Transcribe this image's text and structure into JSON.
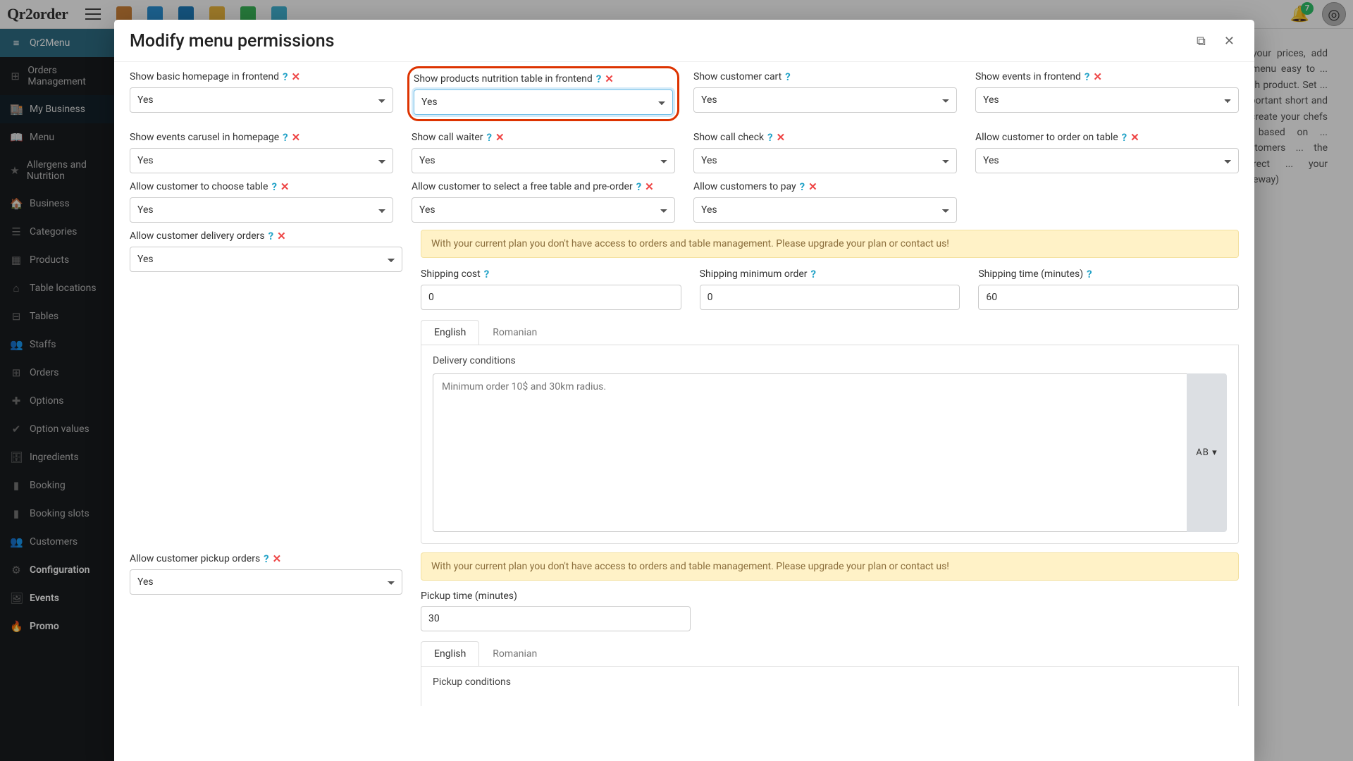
{
  "brand": "Qr2order",
  "notification_count": "7",
  "sidebar": {
    "items": [
      {
        "label": "Qr2Menu",
        "icon": "≡"
      },
      {
        "label": "Orders Management",
        "icon": "⊞"
      },
      {
        "label": "My Business",
        "icon": "🏬"
      },
      {
        "label": "Menu",
        "icon": "📖"
      },
      {
        "label": "Allergens and Nutrition",
        "icon": "★"
      },
      {
        "label": "Business",
        "icon": "🏠"
      },
      {
        "label": "Categories",
        "icon": "☰"
      },
      {
        "label": "Products",
        "icon": "▦"
      },
      {
        "label": "Table locations",
        "icon": "⌂"
      },
      {
        "label": "Tables",
        "icon": "⊟"
      },
      {
        "label": "Staffs",
        "icon": "👥"
      },
      {
        "label": "Orders",
        "icon": "⊞"
      },
      {
        "label": "Options",
        "icon": "✚"
      },
      {
        "label": "Option values",
        "icon": "✔"
      },
      {
        "label": "Ingredients",
        "icon": "🗄"
      },
      {
        "label": "Booking",
        "icon": "▮"
      },
      {
        "label": "Booking slots",
        "icon": "▮"
      },
      {
        "label": "Customers",
        "icon": "👥"
      },
      {
        "label": "Configuration",
        "icon": "⚙"
      },
      {
        "label": "Events",
        "icon": "🖼"
      },
      {
        "label": "Promo",
        "icon": "🔥"
      }
    ]
  },
  "bg_text": "... your prices, add ... menu easy to ... each product. Set ... important short and ... create your chefs ... based on ... customers ... the correct ... your gateway)",
  "modal": {
    "title": "Modify menu permissions",
    "rows": [
      [
        {
          "label": "Show basic homepage in frontend",
          "value": "Yes",
          "help": true,
          "remove": true,
          "highlight": false
        },
        {
          "label": "Show products nutrition table in frontend",
          "value": "Yes",
          "help": true,
          "remove": true,
          "highlight": true
        },
        {
          "label": "Show customer cart",
          "value": "Yes",
          "help": true,
          "remove": false,
          "highlight": false
        },
        {
          "label": "Show events in frontend",
          "value": "Yes",
          "help": true,
          "remove": true,
          "highlight": false
        }
      ],
      [
        {
          "label": "Show events carusel in homepage",
          "value": "Yes",
          "help": true,
          "remove": true
        },
        {
          "label": "Show call waiter",
          "value": "Yes",
          "help": true,
          "remove": true
        },
        {
          "label": "Show call check",
          "value": "Yes",
          "help": true,
          "remove": true
        },
        {
          "label": "Allow customer to order on table",
          "value": "Yes",
          "help": true,
          "remove": true
        }
      ],
      [
        {
          "label": "Allow customer to choose table",
          "value": "Yes",
          "help": true,
          "remove": true
        },
        {
          "label": "Allow customer to select a free table and pre-order",
          "value": "Yes",
          "help": true,
          "remove": true
        },
        {
          "label": "Allow customers to pay",
          "value": "Yes",
          "help": true,
          "remove": true
        },
        null
      ],
      [
        {
          "label": "Allow customer delivery orders",
          "value": "Yes",
          "help": true,
          "remove": true
        },
        null,
        null,
        null
      ]
    ],
    "alert_text": "With your current plan you don't have access to orders and table management. Please upgrade your plan or contact us!",
    "shipping": {
      "cost_label": "Shipping cost",
      "cost_value": "0",
      "min_label": "Shipping minimum order",
      "min_value": "0",
      "time_label": "Shipping time (minutes)",
      "time_value": "60"
    },
    "tabs": {
      "en": "English",
      "ro": "Romanian"
    },
    "delivery_conditions_label": "Delivery conditions",
    "delivery_placeholder": "Minimum order 10$ and 30km radius.",
    "ta_side": "AB ▾",
    "pickup": {
      "label": "Allow customer pickup orders",
      "value": "Yes",
      "time_label": "Pickup time (minutes)",
      "time_value": "30",
      "cond_label": "Pickup conditions"
    }
  }
}
